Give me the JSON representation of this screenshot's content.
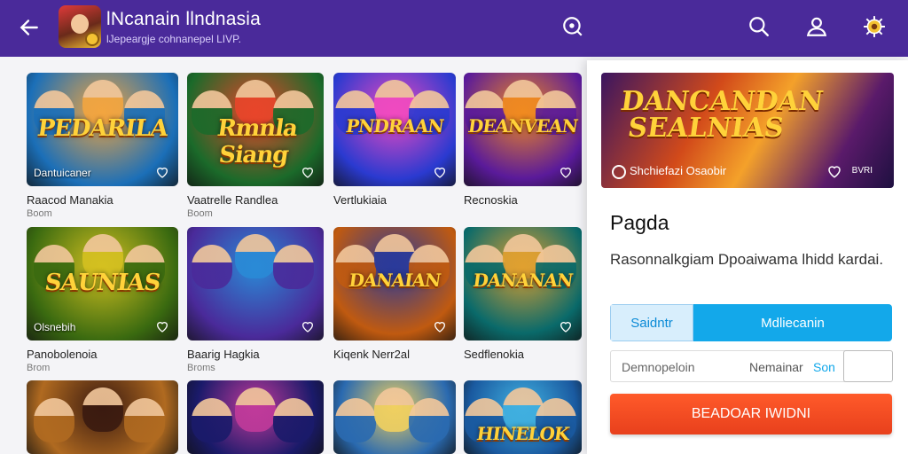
{
  "header": {
    "title": "lNcanain llndnasia",
    "subtitle": "lJepeargje cohnanepel LIVP.",
    "icons": [
      "back-arrow-icon",
      "compass-icon",
      "search-icon",
      "profile-icon",
      "settings-icon"
    ]
  },
  "games": [
    {
      "logo": "PEDARILA",
      "caption": "Dantuicaner",
      "name": "Raacod Manakia",
      "meta": "Boom",
      "colors": [
        "#1b6fb8",
        "#f2a540"
      ]
    },
    {
      "logo": "Rmnla Siang",
      "caption": "",
      "name": "Vaatrelle Randlea",
      "meta": "Boom",
      "colors": [
        "#1b6a2a",
        "#e8452a"
      ]
    },
    {
      "logo": "PNDRAAN",
      "caption": "",
      "name": "Vertlukiaia",
      "meta": "",
      "colors": [
        "#2a3ad0",
        "#f04ac0"
      ]
    },
    {
      "logo": "DEANVEAN",
      "caption": "",
      "name": "Recnoskia",
      "meta": "",
      "colors": [
        "#5a1a9a",
        "#f08a20"
      ]
    },
    {
      "logo": "SAUNIAS",
      "caption": "Olsnebih",
      "name": "Panobolenoia",
      "meta": "Brom",
      "colors": [
        "#3a6a10",
        "#d4c020"
      ]
    },
    {
      "logo": "",
      "caption": "",
      "name": "Baarig Hagkia",
      "meta": "Broms",
      "colors": [
        "#4a2a9a",
        "#2a8ad6"
      ]
    },
    {
      "logo": "DANAIAN",
      "caption": "",
      "name": "Kiqenk Nerr2al",
      "meta": "",
      "colors": [
        "#c05a10",
        "#2a3a9a"
      ]
    },
    {
      "logo": "DANANAN",
      "caption": "",
      "name": "Sedflenokia",
      "meta": "",
      "colors": [
        "#0a6a6a",
        "#e0a030"
      ]
    },
    {
      "logo": "",
      "caption": "",
      "name": "",
      "meta": "",
      "colors": [
        "#b06a20",
        "#3a1a10"
      ]
    },
    {
      "logo": "",
      "caption": "",
      "name": "",
      "meta": "",
      "colors": [
        "#1a1a6a",
        "#c03a9a"
      ]
    },
    {
      "logo": "",
      "caption": "",
      "name": "",
      "meta": "",
      "colors": [
        "#2a6ab0",
        "#f0d060"
      ]
    },
    {
      "logo": "HINELOK",
      "caption": "",
      "name": "",
      "meta": "",
      "colors": [
        "#1a5aa0",
        "#40b0e0"
      ]
    }
  ],
  "panel": {
    "banner_logo": "DANCANDAN SEALNIAS",
    "banner_caption": "Shchiefazi Osaobir",
    "banner_tag": "BVRI",
    "title": "Pagda",
    "description": "Rasonnalkgiam Dpoaiwama lhidd kardai.",
    "segment_left": "Saidntr",
    "segment_right": "Mdliecanin",
    "field_placeholder": "Demnopeloin",
    "field_label": "Nemainar",
    "field_accent": "Son",
    "cta_label": "BEADOAR IWIDNI"
  }
}
